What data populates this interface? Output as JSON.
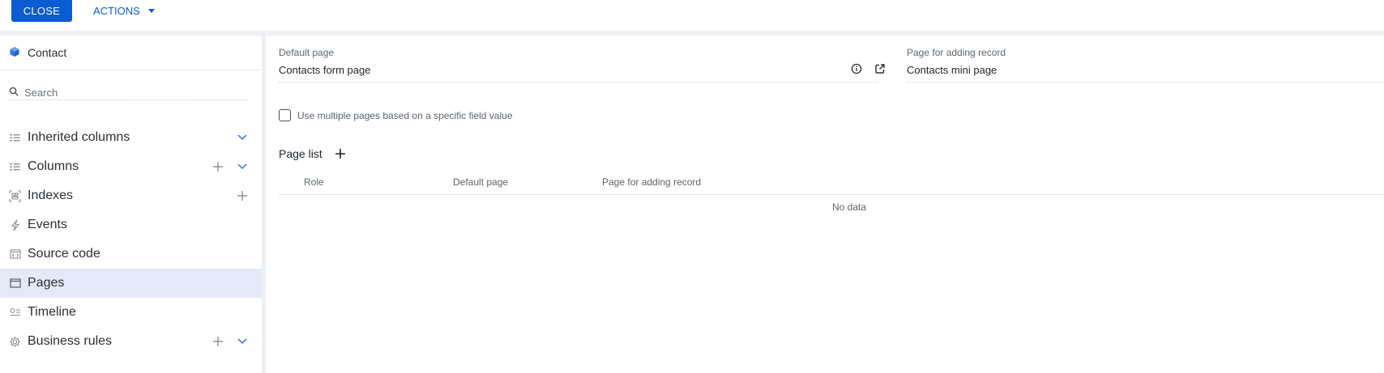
{
  "toolbar": {
    "close_label": "CLOSE",
    "actions_label": "ACTIONS"
  },
  "sidebar": {
    "entity_name": "Contact",
    "search": {
      "placeholder": "Search",
      "value": ""
    },
    "items": [
      {
        "label": "Inherited columns",
        "icon": "list-icon",
        "add": false,
        "expand": true,
        "active": false
      },
      {
        "label": "Columns",
        "icon": "list-icon",
        "add": true,
        "expand": true,
        "active": false
      },
      {
        "label": "Indexes",
        "icon": "index-icon",
        "add": true,
        "expand": false,
        "active": false
      },
      {
        "label": "Events",
        "icon": "lightning-icon",
        "add": false,
        "expand": false,
        "active": false
      },
      {
        "label": "Source code",
        "icon": "code-icon",
        "add": false,
        "expand": false,
        "active": false
      },
      {
        "label": "Pages",
        "icon": "window-icon",
        "add": false,
        "expand": false,
        "active": true
      },
      {
        "label": "Timeline",
        "icon": "timeline-icon",
        "add": false,
        "expand": false,
        "active": false
      },
      {
        "label": "Business rules",
        "icon": "gear-rules-icon",
        "add": true,
        "expand": true,
        "active": false
      }
    ]
  },
  "main": {
    "default_page": {
      "label": "Default page",
      "value": "Contacts form page"
    },
    "adding_page": {
      "label": "Page for adding record",
      "value": "Contacts mini page"
    },
    "multiple_pages_label": "Use multiple pages based on a specific field value",
    "page_list": {
      "title": "Page list",
      "columns": [
        "Role",
        "Default page",
        "Page for adding record"
      ],
      "empty_text": "No data"
    }
  },
  "colors": {
    "accent": "#0b5bd3",
    "active_bg": "#e3e9f7",
    "separator": "#eef0f3"
  }
}
